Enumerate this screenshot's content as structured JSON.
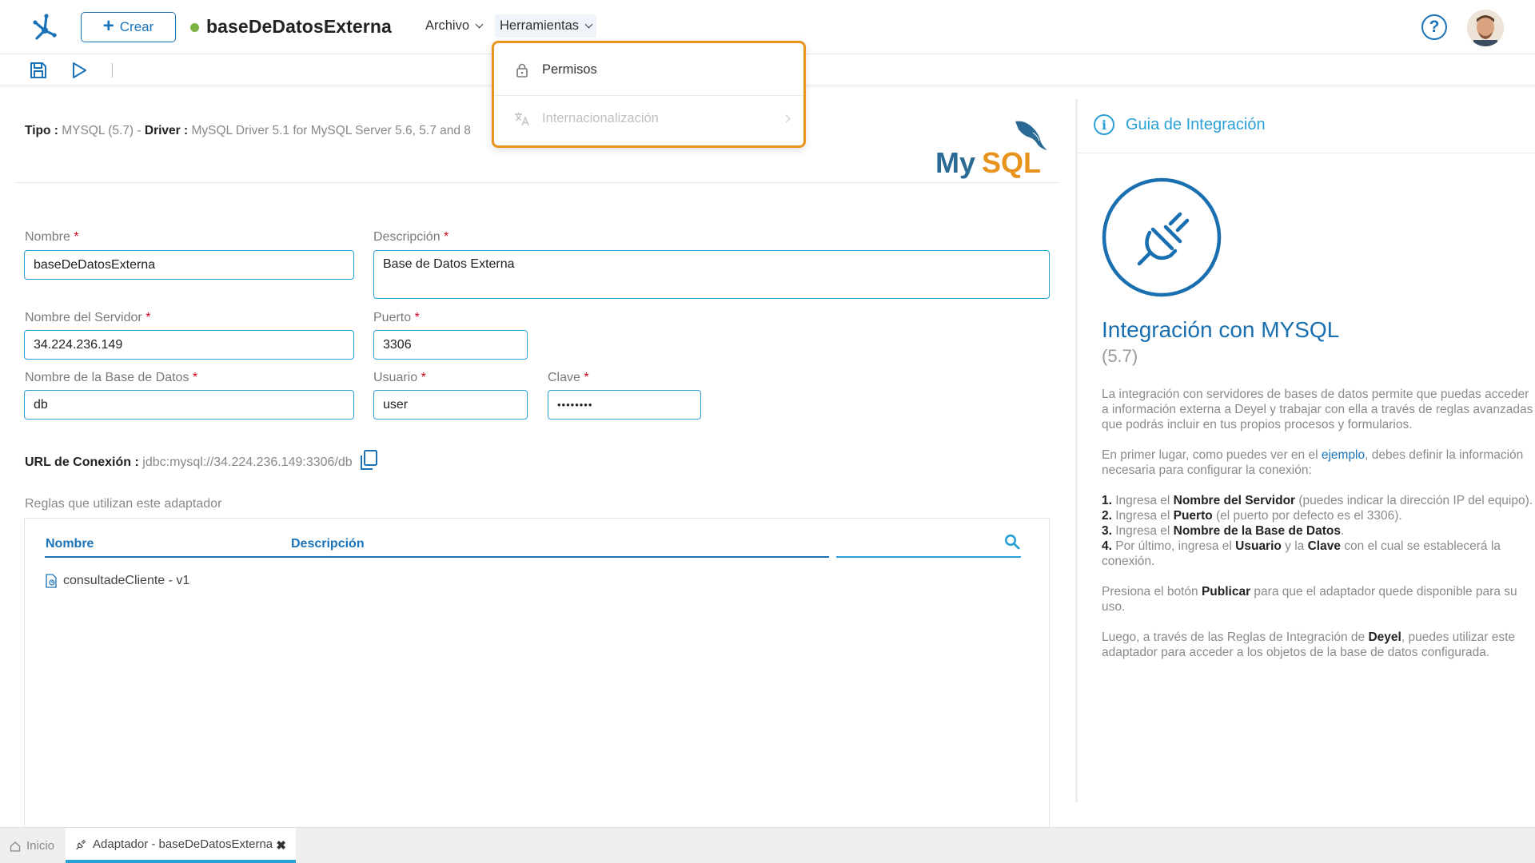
{
  "header": {
    "create_label": "Crear",
    "app_title": "baseDeDatosExterna",
    "menu": {
      "archivo": "Archivo",
      "herramientas": "Herramientas"
    },
    "help_glyph": "?"
  },
  "dropdown": {
    "items": [
      {
        "label": "Permisos",
        "icon": "lock-icon",
        "enabled": true
      },
      {
        "label": "Internacionalización",
        "icon": "translate-icon",
        "enabled": false
      }
    ]
  },
  "meta": {
    "tipo_label": "Tipo :",
    "tipo_value": "MYSQL (5.7)",
    "sep": " - ",
    "driver_label": "Driver :",
    "driver_value": "MySQL Driver 5.1 for MySQL Server 5.6, 5.7 and 8",
    "logo_text": "MySQL"
  },
  "form": {
    "nombre": {
      "label": "Nombre",
      "value": "baseDeDatosExterna"
    },
    "descripcion": {
      "label": "Descripción",
      "value": "Base de Datos Externa"
    },
    "servidor": {
      "label": "Nombre del Servidor",
      "value": "34.224.236.149"
    },
    "puerto": {
      "label": "Puerto",
      "value": "3306"
    },
    "basedatos": {
      "label": "Nombre de la Base de Datos",
      "value": "db"
    },
    "usuario": {
      "label": "Usuario",
      "value": "user"
    },
    "clave": {
      "label": "Clave",
      "value": "••••••••"
    },
    "required_mark": "*"
  },
  "connection": {
    "label": "URL de Conexión :",
    "value": "jdbc:mysql://34.224.236.149:3306/db"
  },
  "rules": {
    "title": "Reglas que utilizan este adaptador",
    "columns": [
      "Nombre",
      "Descripción"
    ],
    "rows": [
      {
        "name": "consultadeCliente - v1"
      }
    ]
  },
  "guide": {
    "header": "Guia de Integración",
    "title": "Integración con MYSQL",
    "version": "(5.7)",
    "p1": "La integración con servidores de bases de datos permite que puedas acceder a información externa a Deyel y trabajar con ella a través de reglas avanzadas que podrás incluir en tus propios procesos y formularios.",
    "p2_a": "En primer lugar, como puedes ver en el ",
    "p2_link": "ejemplo",
    "p2_b": ", debes definir la información necesaria para configurar la conexión:",
    "steps": [
      {
        "n": "1.",
        "a": " Ingresa el ",
        "b": "Nombre del Servidor",
        "c": " (puedes indicar la dirección IP del equipo)."
      },
      {
        "n": "2.",
        "a": " Ingresa el ",
        "b": "Puerto",
        "c": " (el puerto por defecto es el 3306)."
      },
      {
        "n": "3.",
        "a": " Ingresa el ",
        "b": "Nombre de la Base de Datos",
        "c": "."
      },
      {
        "n": "4.",
        "a": " Por último, ingresa el ",
        "b": "Usuario",
        "c": " y la ",
        "d": "Clave",
        "e": " con el cual se establecerá la conexión."
      }
    ],
    "p3_a": "Presiona el botón ",
    "p3_b": "Publicar",
    "p3_c": " para que el adaptador quede disponible para su uso.",
    "p4_a": "Luego, a través de las Reglas de Integración de ",
    "p4_b": "Deyel",
    "p4_c": ", puedes utilizar este adaptador para acceder a los objetos de la base de datos configurada."
  },
  "bottom_tabs": {
    "home": "Inicio",
    "active": "Adaptador - baseDeDatosExterna",
    "close_glyph": "✖"
  },
  "colors": {
    "primary": "#1a73b8",
    "accent": "#2aa1d6",
    "highlight": "#e8931d",
    "status_ok": "#7cb342",
    "required": "#d0021b"
  }
}
